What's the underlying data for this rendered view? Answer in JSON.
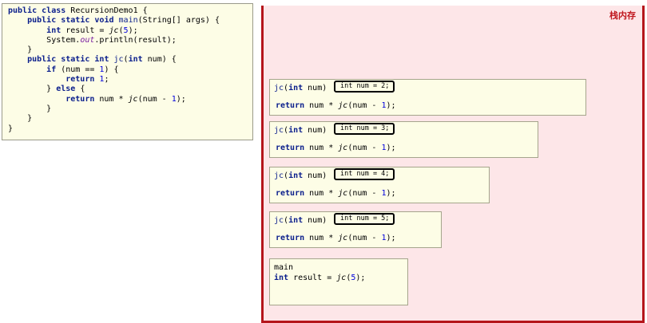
{
  "code": {
    "line1": {
      "public": "public",
      "class": "class",
      "name": "RecursionDemo1",
      "brace": " {"
    },
    "line2": {
      "public": "public",
      "static": "static",
      "void": "void",
      "main": "main",
      "params": "(String[] args) {"
    },
    "line3": {
      "int": "int",
      "decl": " result = ",
      "call": "jc",
      "open": "(",
      "arg": "5",
      "close": ");"
    },
    "line4": {
      "system": "System.",
      "out": "out",
      "rest": ".println(result);"
    },
    "line5": "}",
    "line6": {
      "public": "public",
      "static": "static",
      "int": "int",
      "jc": "jc",
      "open": "(",
      "param_int": "int",
      "rest": " num) {"
    },
    "line7": {
      "if": "if",
      "cond": " (num == ",
      "one": "1",
      "end": ") {"
    },
    "line8": {
      "return": "return",
      "space": " ",
      "one": "1",
      "semi": ";"
    },
    "line9": {
      "brace": "} ",
      "else": "else",
      "rest": " {"
    },
    "line10": {
      "return": "return",
      "expr": " num * ",
      "jc": "jc",
      "arg": "(num - ",
      "one": "1",
      "end": ");"
    },
    "line11": "}",
    "line12": "}",
    "line13": "}"
  },
  "stack": {
    "title": "栈内存",
    "frames": [
      {
        "head_jc": "jc",
        "head_open": "(",
        "head_int": "int",
        "head_rest": " num)",
        "var": "int num = 2;",
        "ret": "return",
        "expr": " num * ",
        "jc": "jc",
        "arg": "(num - ",
        "one": "1",
        "end": ");"
      },
      {
        "head_jc": "jc",
        "head_open": "(",
        "head_int": "int",
        "head_rest": " num)",
        "var": "int num = 3;",
        "ret": "return",
        "expr": " num * ",
        "jc": "jc",
        "arg": "(num - ",
        "one": "1",
        "end": ");"
      },
      {
        "head_jc": "jc",
        "head_open": "(",
        "head_int": "int",
        "head_rest": " num)",
        "var": "int num = 4;",
        "ret": "return",
        "expr": " num * ",
        "jc": "jc",
        "arg": "(num - ",
        "one": "1",
        "end": ");"
      },
      {
        "head_jc": "jc",
        "head_open": "(",
        "head_int": "int",
        "head_rest": " num)",
        "var": "int num = 5;",
        "ret": "return",
        "expr": " num * ",
        "jc": "jc",
        "arg": "(num - ",
        "one": "1",
        "end": ");"
      }
    ],
    "main": {
      "label": "main",
      "int": "int",
      "decl": " result = ",
      "jc": "jc",
      "open": "(",
      "arg": "5",
      "close": ");"
    }
  },
  "colors": {
    "stack_border": "#b5151b",
    "stack_bg": "#fde6e8",
    "frame_bg": "#fdfde6",
    "keyword": "#0a1e8c",
    "number": "#0000dd",
    "static_field": "#7a1fa2"
  }
}
